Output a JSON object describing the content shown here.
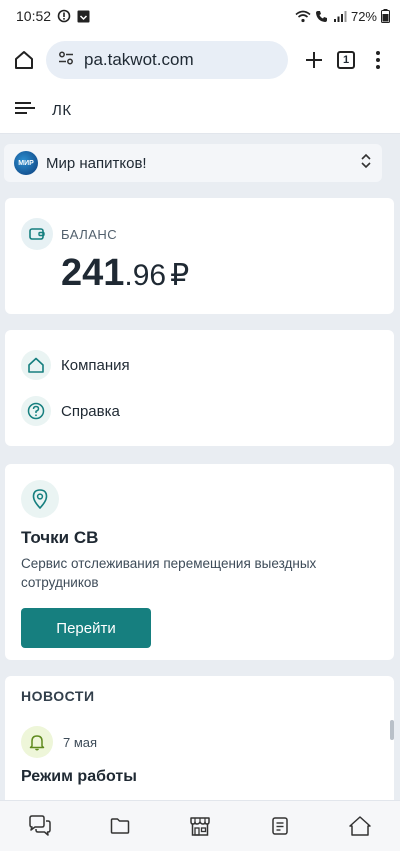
{
  "status_bar": {
    "time": "10:52",
    "battery": "72%"
  },
  "browser": {
    "url": "pa.takwot.com",
    "tabs_count": "1"
  },
  "header": {
    "title": "ЛК"
  },
  "company": {
    "logo_text": "МИР",
    "name": "Мир напитков!"
  },
  "balance": {
    "label": "БАЛАНС",
    "integer": "241",
    "fraction": ".96",
    "currency": "₽"
  },
  "menu": {
    "company_label": "Компания",
    "help_label": "Справка"
  },
  "points": {
    "title": "Точки СВ",
    "description": "Сервис отслеживания перемещения выездных сотрудников",
    "button_label": "Перейти"
  },
  "news": {
    "header": "НОВОСТИ",
    "item_date": "7 мая",
    "item_title": "Режим работы"
  },
  "colors": {
    "accent": "#167f7f",
    "background": "#e9edf2",
    "card": "#ffffff"
  }
}
